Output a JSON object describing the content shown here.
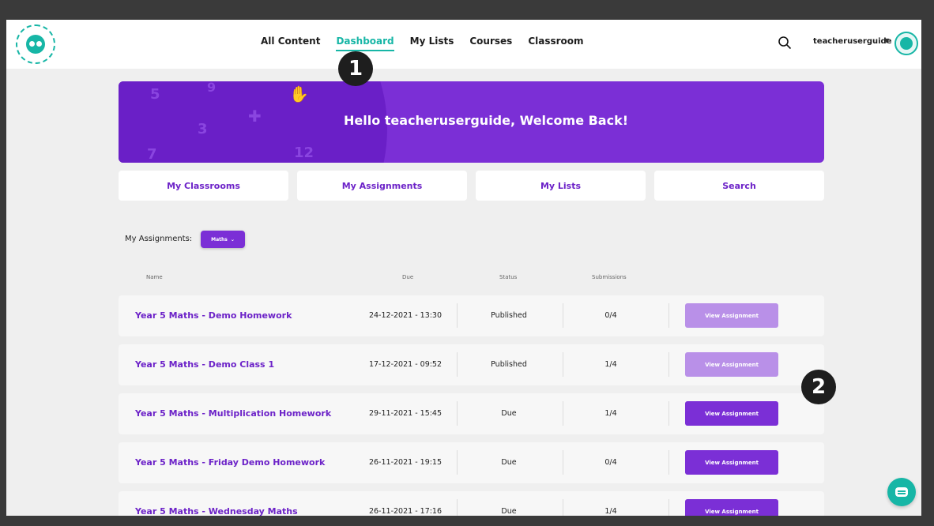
{
  "nav": {
    "items": [
      {
        "label": "All Content",
        "active": false
      },
      {
        "label": "Dashboard",
        "active": true
      },
      {
        "label": "My Lists",
        "active": false
      },
      {
        "label": "Courses",
        "active": false
      },
      {
        "label": "Classroom",
        "active": false
      }
    ],
    "username": "teacheruserguide",
    "search_icon": "search-icon"
  },
  "callouts": [
    "1",
    "2"
  ],
  "hero": {
    "title": "Hello teacheruserguide, Welcome Back!",
    "decorations": [
      "5",
      "9",
      "3",
      "12",
      "7"
    ]
  },
  "quick_tabs": [
    "My Classrooms",
    "My Assignments",
    "My Lists",
    "Search"
  ],
  "assignments": {
    "label": "My Assignments:",
    "subject": "Maths",
    "columns": [
      "Name",
      "Due",
      "Status",
      "Submissions"
    ],
    "rows": [
      {
        "name": "Year 5 Maths - Demo Homework",
        "due": "24-12-2021 - 13:30",
        "status": "Published",
        "submissions": "0/4",
        "action": "View Assignment",
        "enabled": false
      },
      {
        "name": "Year 5 Maths - Demo Class 1",
        "due": "17-12-2021 - 09:52",
        "status": "Published",
        "submissions": "1/4",
        "action": "View Assignment",
        "enabled": false
      },
      {
        "name": "Year 5 Maths - Multiplication Homework",
        "due": "29-11-2021 - 15:45",
        "status": "Due",
        "submissions": "1/4",
        "action": "View Assignment",
        "enabled": true
      },
      {
        "name": "Year 5 Maths - Friday Demo Homework",
        "due": "26-11-2021 - 19:15",
        "status": "Due",
        "submissions": "0/4",
        "action": "View Assignment",
        "enabled": true
      },
      {
        "name": "Year 5 Maths - Wednesday Maths",
        "due": "26-11-2021 - 17:16",
        "status": "Due",
        "submissions": "1/4",
        "action": "View Assignment",
        "enabled": true
      }
    ]
  },
  "colors": {
    "brand_purple": "#7b2fd6",
    "teal": "#17b6a6",
    "disabled_button": "#b990e8"
  }
}
